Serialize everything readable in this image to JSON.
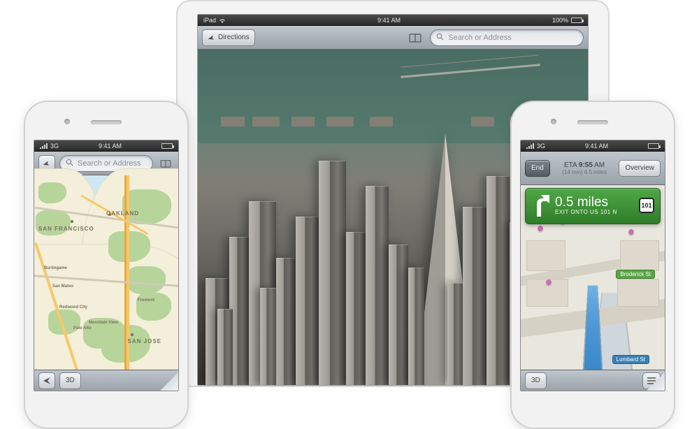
{
  "ipad": {
    "status": {
      "carrier": "iPad",
      "wifi": "wifi",
      "time": "9:41 AM",
      "battery_pct": "100%"
    },
    "toolbar": {
      "directions_label": "Directions",
      "bookmarks_label": "Bookmarks",
      "search_placeholder": "Search or Address"
    }
  },
  "iphone_left": {
    "status": {
      "carrier": "3G",
      "time": "9:41 AM"
    },
    "toolbar": {
      "search_placeholder": "Search or Address"
    },
    "bottom": {
      "mode_3d": "3D"
    },
    "map": {
      "labels": {
        "san_francisco": "SAN FRANCISCO",
        "oakland": "OAKLAND",
        "san_jose": "SAN JOSE",
        "burlingame": "Burlingame",
        "san_mateo": "San Mateo",
        "redwood_city": "Redwood City",
        "palo_alto": "Palo Alto",
        "fremont": "Fremont",
        "mountain_view": "Mountain View"
      }
    }
  },
  "iphone_right": {
    "status": {
      "carrier": "3G",
      "time": "9:41 AM"
    },
    "nav_top": {
      "end_label": "End",
      "overview_label": "Overview",
      "eta_prefix": "ETA",
      "eta_time": "9:55",
      "eta_suffix": "AM",
      "eta_sub": "(14 min)  6.5 miles"
    },
    "sign": {
      "distance": "0.5 miles",
      "instruction": "EXIT ONTO US 101 N",
      "shield": "101"
    },
    "bottom": {
      "mode_3d": "3D"
    },
    "map": {
      "street_broderick": "Broderick St",
      "street_lombard": "Lombard St"
    }
  }
}
